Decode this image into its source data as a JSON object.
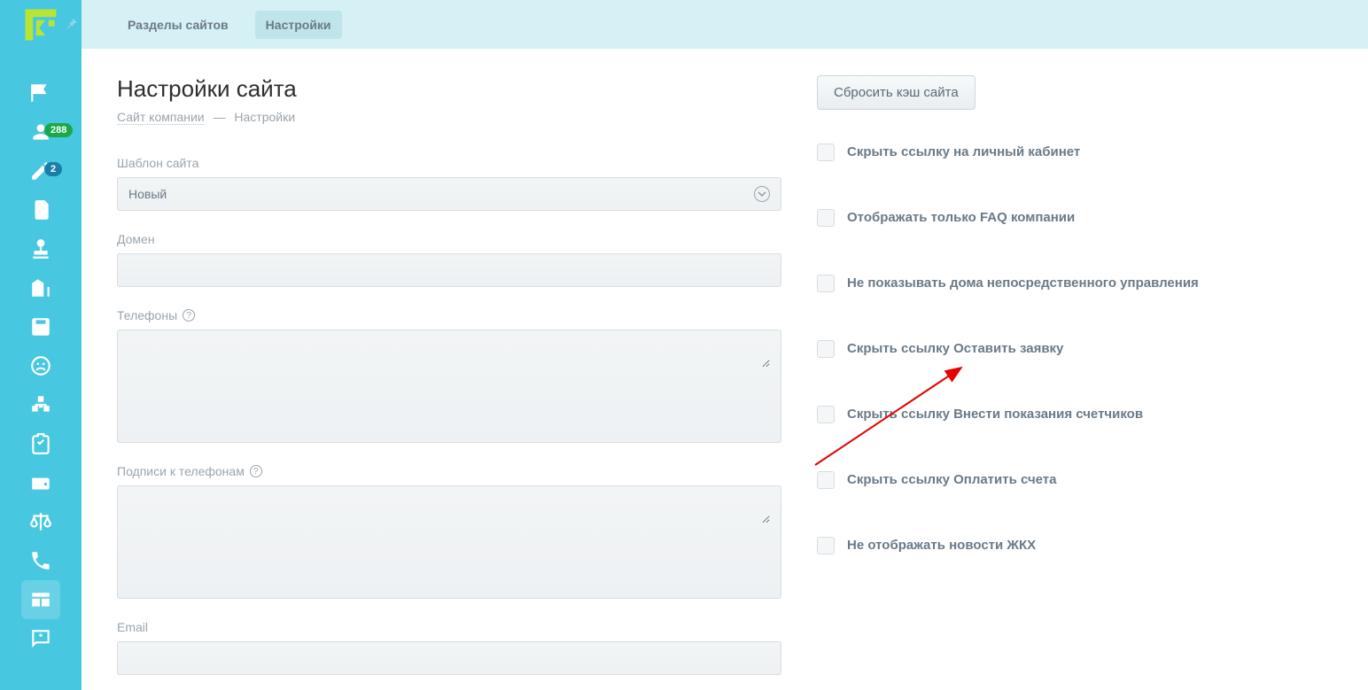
{
  "topbar": {
    "tab_sections": "Разделы сайтов",
    "tab_settings": "Настройки"
  },
  "sidebar": {
    "badge_users": "288",
    "badge_edit": "2"
  },
  "page": {
    "title": "Настройки сайта",
    "crumb_site": "Сайт компании",
    "crumb_sep": "—",
    "crumb_current": "Настройки"
  },
  "fields": {
    "template_label": "Шаблон сайта",
    "template_value": "Новый",
    "domain_label": "Домен",
    "domain_value": "",
    "phones_label": "Телефоны",
    "phones_value": "",
    "phone_captions_label": "Подписи к телефонам",
    "phone_captions_value": "",
    "email_label": "Email",
    "email_value": ""
  },
  "actions": {
    "reset_cache": "Сбросить кэш сайта"
  },
  "checks": {
    "hide_lk": "Скрыть ссылку на личный кабинет",
    "only_faq": "Отображать только FAQ компании",
    "hide_direct_houses": "Не показывать дома непосредственного управления",
    "hide_leave_request": "Скрыть ссылку Оставить заявку",
    "hide_meters": "Скрыть ссылку Внести показания счетчиков",
    "hide_pay": "Скрыть ссылку Оплатить счета",
    "hide_news": "Не отображать новости ЖКХ"
  }
}
